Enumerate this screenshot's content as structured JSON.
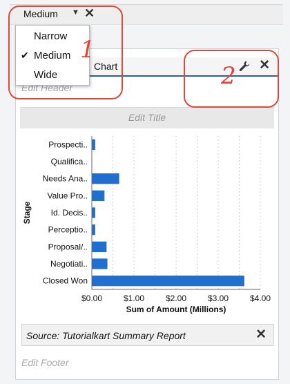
{
  "toolbar": {
    "width_value": "Medium",
    "caret": "▼",
    "close": "✕"
  },
  "dropdown": {
    "items": [
      {
        "label": "Narrow",
        "checked": false
      },
      {
        "label": "Medium",
        "checked": true
      },
      {
        "label": "Wide",
        "checked": false
      }
    ],
    "check_glyph": "✔"
  },
  "component": {
    "header_partial_text": "Chart",
    "edit_header": "Edit Header",
    "edit_title": "Edit Title",
    "header_close": "✕",
    "source": "Source: Tutorialkart Summary Report",
    "source_close": "✕",
    "edit_footer": "Edit Footer"
  },
  "annotations": {
    "one": "1",
    "two": "2",
    "color": "#e0463a"
  },
  "chart_data": {
    "type": "bar",
    "orientation": "horizontal",
    "categories": [
      "Prospecti..",
      "Qualifica..",
      "Needs Ana..",
      "Value Pro..",
      "Id. Decis..",
      "Perceptio..",
      "Proposal/..",
      "Negotiati..",
      "Closed Won"
    ],
    "values": [
      0.08,
      0.0,
      0.65,
      0.3,
      0.08,
      0.08,
      0.35,
      0.37,
      3.62
    ],
    "xlabel": "Sum of Amount (Millions)",
    "ylabel": "Stage",
    "xlim": [
      0,
      4
    ],
    "xticks": [
      "$0.00",
      "$1.00",
      "$2.00",
      "$3.00",
      "$4.00"
    ],
    "bar_color": "#1f6fd1",
    "grid": "vertical dashed"
  }
}
